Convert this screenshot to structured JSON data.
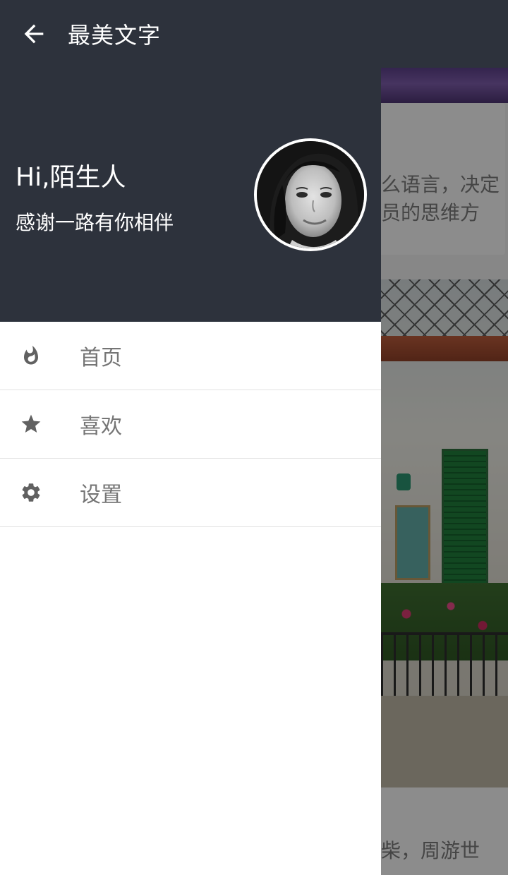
{
  "toolbar": {
    "title": "最美文字",
    "back_icon": "arrow-back-icon",
    "background": "#2d323c"
  },
  "drawer": {
    "greeting": "Hi,陌生人",
    "subtitle": "感谢一路有你相伴",
    "avatar_icon": "user-avatar",
    "menu": [
      {
        "label": "首页",
        "icon": "flame-icon"
      },
      {
        "label": "喜欢",
        "icon": "star-icon"
      },
      {
        "label": "设置",
        "icon": "gear-icon"
      }
    ]
  },
  "background_content": {
    "card1_line1": "么语言，决定",
    "card1_line2": "员的思维方",
    "card2_line1": "柴，周游世"
  }
}
